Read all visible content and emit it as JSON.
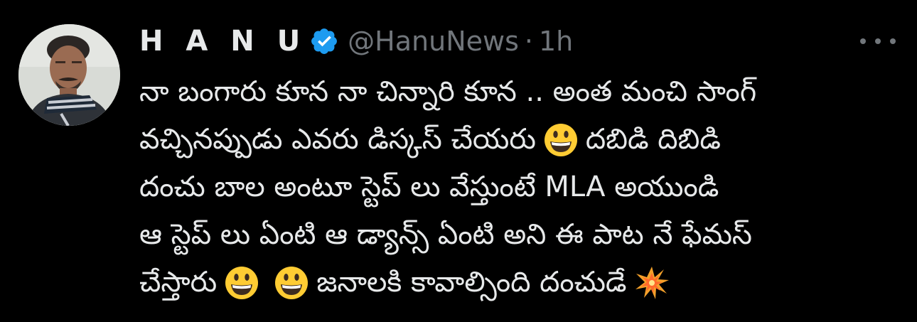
{
  "author": {
    "name": "H A N U",
    "handle": "@HanuNews",
    "separator": "·",
    "time": "1h"
  },
  "icons": {
    "verified": "verified-badge-icon",
    "more": "more-dots-icon",
    "grin": "grinning-face-emoji",
    "burst": "collision-emoji"
  },
  "colors": {
    "background": "#000000",
    "text": "#e7e9ea",
    "muted": "#71767b",
    "verified": "#1d9bf0"
  },
  "tweet": {
    "line1": "నా బంగారు కూన నా చిన్నారి కూన .. అంత మంచి సాంగ్",
    "line2a": "వచ్చినప్పుడు ఎవరు డిస్కస్ చేయరు",
    "line2b": "దబిడి దిబిడి",
    "line3": "దంచు బాల అంటూ స్టెప్ లు వేస్తుంటే MLA అయుండి",
    "line4": "ఆ స్టెప్ లు ఏంటి ఆ డ్యాన్స్ ఏంటి అని ఈ పాట నే ఫేమస్",
    "line5a": "చేస్తారు",
    "line5b": "జనాలకి కావాల్సింది దంచుడే"
  }
}
